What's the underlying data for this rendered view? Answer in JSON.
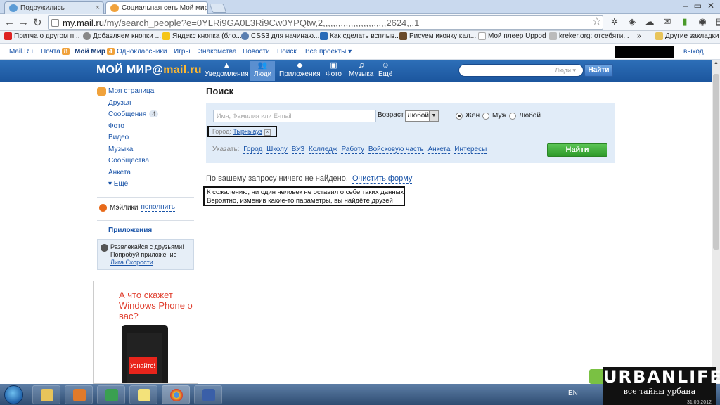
{
  "browser": {
    "tabs": [
      {
        "title": "Подружились",
        "active": false
      },
      {
        "title": "Социальная сеть Мой мир",
        "active": true
      }
    ],
    "url_host": "my.mail.ru",
    "url_path": "/my/search_people?e=0YLRi9GA0L3Ri9Cw0YPQtw,2,,,,,,,,,,,,,,,,,,,,,,,,,2624,,,1",
    "bookmarks": [
      "Притча о другом п...",
      "Добавляем кнопки ...",
      "Яндекс кнопка (бло...",
      "CSS3 для начинаю...",
      "Как сделать всплыв...",
      "Рисуем иконку кал...",
      "Мой плеер Uppod",
      "kreker.org: отсебяти..."
    ],
    "other_bookmarks": "Другие закладки"
  },
  "topnav": {
    "mailru": "Mail.Ru",
    "pochta": "Почта",
    "pochta_count": "8",
    "moimir": "Мой Мир",
    "moimir_count": "4",
    "odnoklassniki": "Одноклассники",
    "igry": "Игры",
    "znakomstva": "Знакомства",
    "novosti": "Новости",
    "poisk": "Поиск",
    "vse_proekty": "Все проекты ▾",
    "exit": "выход"
  },
  "header": {
    "logo_left": "МОЙ МИР@",
    "logo_right": "mail.ru",
    "nav": [
      {
        "label": "Уведомления",
        "icon": "▲"
      },
      {
        "label": "Люди",
        "icon": "👥"
      },
      {
        "label": "Приложения",
        "icon": "◆"
      },
      {
        "label": "Фото",
        "icon": "▣"
      },
      {
        "label": "Музыка",
        "icon": "♫"
      },
      {
        "label": "Ещё",
        "icon": "☺"
      }
    ],
    "search_scope": "Люди ▾",
    "search_button": "Найти"
  },
  "sidebar": {
    "my_page": "Моя страница",
    "items": [
      "Друзья",
      "Сообщения",
      "Фото",
      "Видео",
      "Музыка",
      "Сообщества",
      "Анкета"
    ],
    "messages_count": "4",
    "more": "▾ Еще",
    "mailiki": "Мэйлики",
    "mailiki_action": "пополнить",
    "apps": "Приложения",
    "promo_line1": "Развлекайся с друзьями!",
    "promo_line2": "Попробуй приложение",
    "promo_link": "Лига Скорости"
  },
  "ad": {
    "text": "А что скажет Windows Phone о вас?",
    "button": "Узнайте!"
  },
  "search": {
    "title": "Поиск",
    "name_placeholder": "Имя, Фамилия или E-mail",
    "age_label": "Возраст",
    "age_value": "Любой",
    "gender_options": [
      "Жен",
      "Муж",
      "Любой"
    ],
    "gender_selected": "Жен",
    "city_label": "Город:",
    "city_value": "Тырныауз",
    "specify_label": "Указать:",
    "specify_links": [
      "Город",
      "Школу",
      "ВУЗ",
      "Колледж",
      "Работу",
      "Войсковую часть",
      "Анкета",
      "Интересы"
    ],
    "find_button": "Найти",
    "no_result": "По вашему запросу ничего не найдено.",
    "clear_form": "Очистить форму",
    "note_line1": "К сожалению, ни один человек не оставил о себе таких данных",
    "note_line2": "Вероятно, изменив какие-то параметры, вы найдёте друзей"
  },
  "taskbar": {
    "lang": "EN",
    "watermark_title": "URBANLIFE",
    "watermark_sub": "все тайны урбана",
    "date": "31.05.2012"
  }
}
